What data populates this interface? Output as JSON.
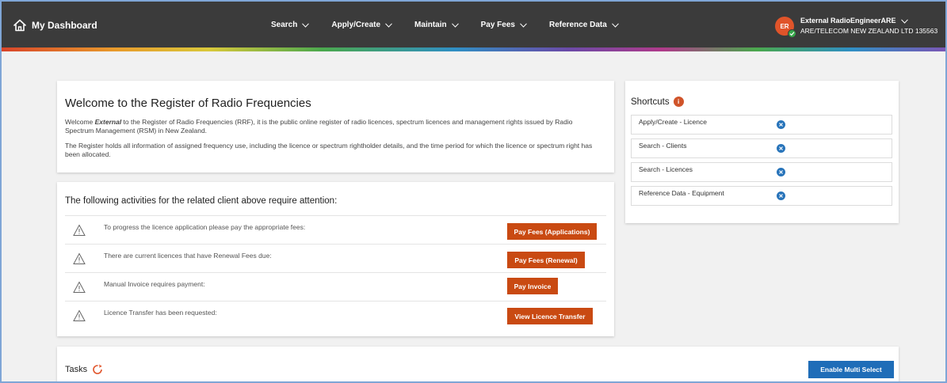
{
  "header": {
    "brand": "My Dashboard",
    "nav": [
      {
        "label": "Search"
      },
      {
        "label": "Apply/Create"
      },
      {
        "label": "Maintain"
      },
      {
        "label": "Pay Fees"
      },
      {
        "label": "Reference Data"
      }
    ],
    "user": {
      "initials": "ER",
      "name": "External RadioEngineerARE",
      "org": "ARE/TELECOM NEW ZEALAND LTD 135563"
    }
  },
  "welcome": {
    "title": "Welcome to the Register of Radio Frequencies",
    "para1_prefix": "Welcome ",
    "para1_em": "External",
    "para1_rest": " to the Register of Radio Frequencies (RRF), it is the public online register of radio licences, spectrum licences and management rights issued by Radio Spectrum Management (RSM) in New Zealand.",
    "para2": "The Register holds all information of assigned frequency use, including the licence or spectrum rightholder details, and the time period for which the licence or spectrum right has been allocated."
  },
  "attention": {
    "title": "The following activities for the related client above require attention:",
    "rows": [
      {
        "text": "To progress the licence application please pay the appropriate fees:",
        "button": "Pay Fees (Applications)"
      },
      {
        "text": "There are current licences that have Renewal Fees due:",
        "button": "Pay Fees (Renewal)"
      },
      {
        "text": "Manual Invoice requires payment:",
        "button": "Pay Invoice"
      },
      {
        "text": "Licence Transfer has been requested:",
        "button": "View Licence Transfer"
      }
    ]
  },
  "shortcuts": {
    "title": "Shortcuts",
    "badge": "i",
    "items": [
      {
        "label": "Apply/Create - Licence"
      },
      {
        "label": "Search - Clients"
      },
      {
        "label": "Search - Licences"
      },
      {
        "label": "Reference Data - Equipment"
      }
    ]
  },
  "tasks": {
    "title": "Tasks",
    "multi_select_label": "Enable Multi Select"
  },
  "colors": {
    "topbar": "#3b3b3b",
    "action_button": "#c94a12",
    "primary_button": "#1f6db8",
    "avatar": "#e0542a",
    "status_online": "#36a74a"
  }
}
